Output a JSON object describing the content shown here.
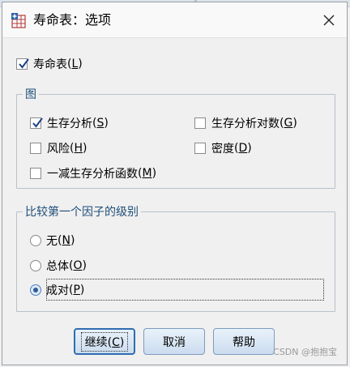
{
  "window": {
    "title": "寿命表：选项"
  },
  "life_table": {
    "label": "寿命表",
    "mnemonic": "L",
    "checked": true
  },
  "plots_group": {
    "legend": "图",
    "items": [
      {
        "label": "生存分析",
        "mnemonic": "S",
        "checked": true
      },
      {
        "label": "生存分析对数",
        "mnemonic": "G",
        "checked": false
      },
      {
        "label": "风险",
        "mnemonic": "H",
        "checked": false
      },
      {
        "label": "密度",
        "mnemonic": "D",
        "checked": false
      },
      {
        "label": "一减生存分析函数",
        "mnemonic": "M",
        "checked": false
      }
    ]
  },
  "compare_group": {
    "legend": "比较第一个因子的级别",
    "options": [
      {
        "label": "无",
        "mnemonic": "N",
        "selected": false
      },
      {
        "label": "总体",
        "mnemonic": "O",
        "selected": false
      },
      {
        "label": "成对",
        "mnemonic": "P",
        "selected": true
      }
    ]
  },
  "buttons": {
    "continue": {
      "label": "继续",
      "mnemonic": "C"
    },
    "cancel": "取消",
    "help": "帮助"
  },
  "watermark": "CSDN @抱抱宝",
  "colors": {
    "accent": "#2f6db0",
    "group_border": "#b8c1cc",
    "legend_text": "#1f4e79"
  }
}
